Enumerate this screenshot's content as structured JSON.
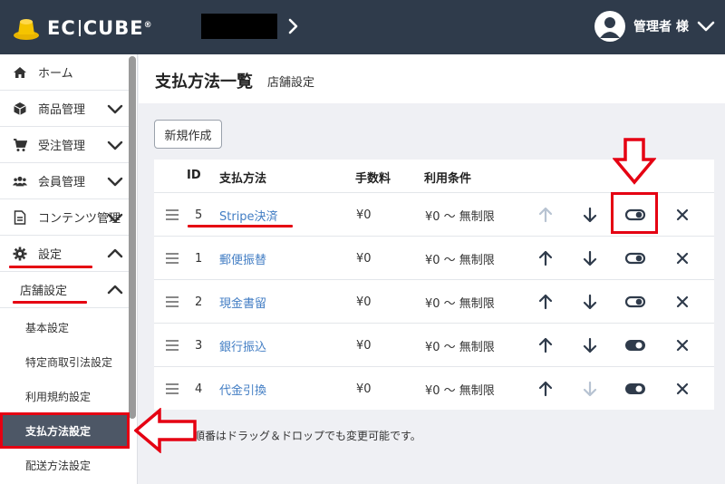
{
  "header": {
    "logo_text_left": "EC",
    "logo_text_right": "CUBE",
    "logo_mark": "®",
    "user_name": "管理者 様"
  },
  "sidebar": {
    "items": [
      {
        "label": "ホーム",
        "icon": "home-icon"
      },
      {
        "label": "商品管理",
        "icon": "cube-icon"
      },
      {
        "label": "受注管理",
        "icon": "cart-icon"
      },
      {
        "label": "会員管理",
        "icon": "users-icon"
      },
      {
        "label": "コンテンツ管理",
        "icon": "document-icon"
      },
      {
        "label": "設定",
        "icon": "gear-icon"
      }
    ],
    "sub_header": "店舗設定",
    "sub_items": [
      "基本設定",
      "特定商取引法設定",
      "利用規約設定",
      "支払方法設定",
      "配送方法設定"
    ]
  },
  "title": {
    "main": "支払方法一覧",
    "sub": "店舗設定"
  },
  "toolbar": {
    "new_label": "新規作成"
  },
  "table": {
    "headers": [
      "ID",
      "支払方法",
      "手数料",
      "利用条件"
    ],
    "rows": [
      {
        "id": "5",
        "name": "Stripe決済",
        "fee": "¥0",
        "condition": "¥0 ～ 無制限",
        "up_enabled": false,
        "down_enabled": true,
        "visible": false
      },
      {
        "id": "1",
        "name": "郵便振替",
        "fee": "¥0",
        "condition": "¥0 ～ 無制限",
        "up_enabled": true,
        "down_enabled": true,
        "visible": false
      },
      {
        "id": "2",
        "name": "現金書留",
        "fee": "¥0",
        "condition": "¥0 ～ 無制限",
        "up_enabled": true,
        "down_enabled": true,
        "visible": false
      },
      {
        "id": "3",
        "name": "銀行振込",
        "fee": "¥0",
        "condition": "¥0 ～ 無制限",
        "up_enabled": true,
        "down_enabled": true,
        "visible": true
      },
      {
        "id": "4",
        "name": "代金引換",
        "fee": "¥0",
        "condition": "¥0 ～ 無制限",
        "up_enabled": true,
        "down_enabled": false,
        "visible": true
      }
    ]
  },
  "note": "順番はドラッグ＆ドロップでも変更可能です。",
  "colors": {
    "header_bg": "#2f3b4b",
    "link": "#437ec4",
    "active_nav": "#4d5766",
    "annotation": "#e50012"
  }
}
